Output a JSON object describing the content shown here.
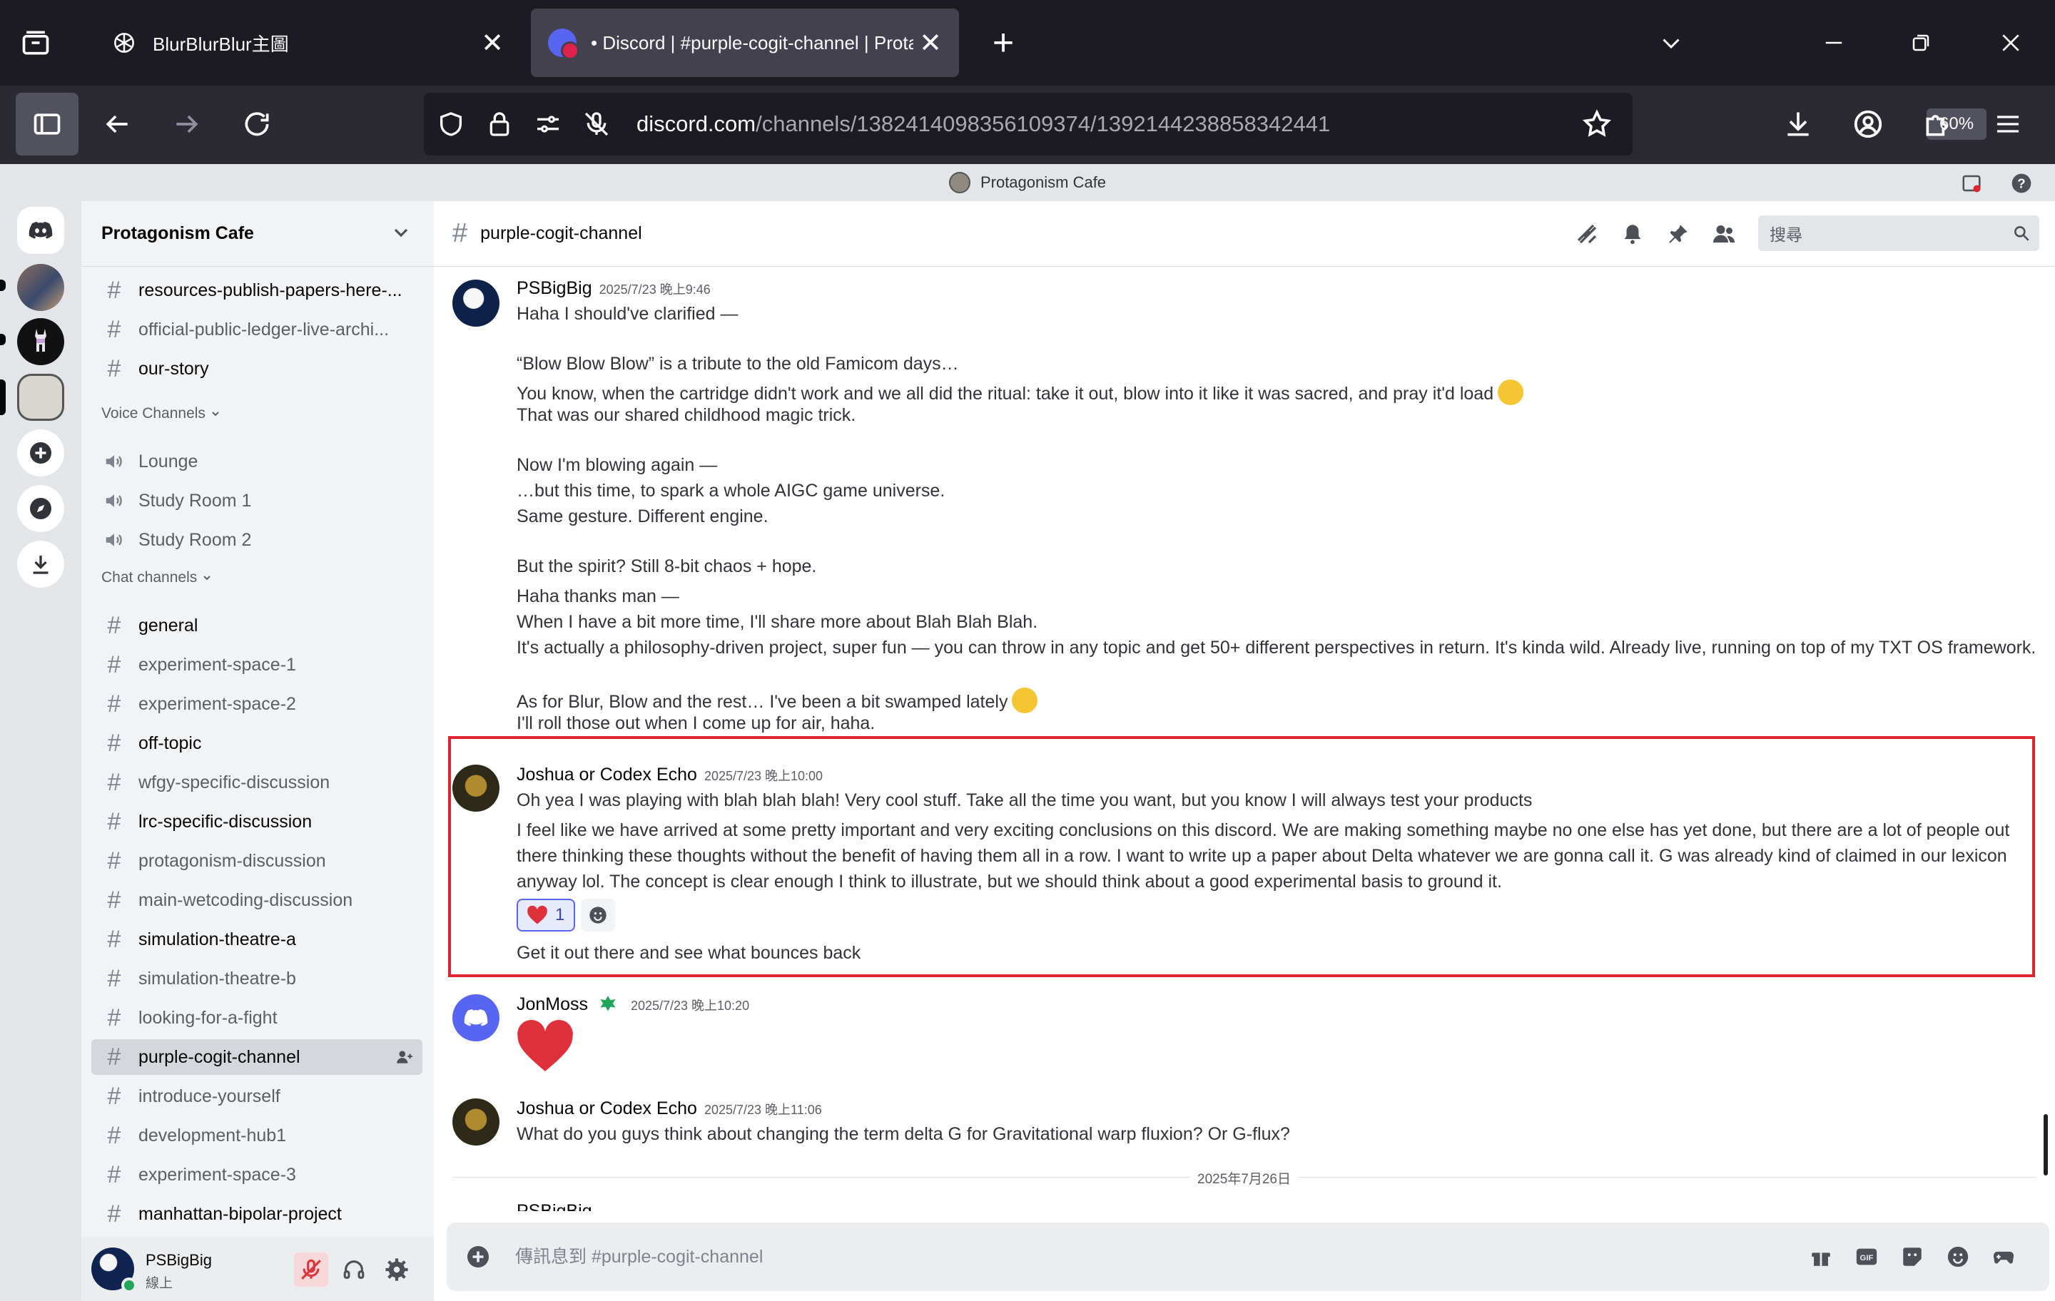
{
  "browser": {
    "tabs": [
      {
        "title": "BlurBlurBlur主圖",
        "active": false
      },
      {
        "title": "• Discord | #purple-cogit-channel | Prota",
        "active": true
      }
    ],
    "url_host": "discord.com",
    "url_path": "/channels/1382414098356109374/1392144238858342441",
    "zoom": "60%"
  },
  "top_strip": {
    "server_name": "Protagonism Cafe"
  },
  "server": {
    "name": "Protagonism Cafe"
  },
  "channels": {
    "top": [
      {
        "name": "resources-publish-papers-here-...",
        "bold": true,
        "unread": true
      },
      {
        "name": "official-public-ledger-live-archi...",
        "bold": false,
        "unread": false
      },
      {
        "name": "our-story",
        "bold": true,
        "unread": true
      }
    ],
    "voice_category": "Voice Channels",
    "voice": [
      "Lounge",
      "Study Room 1",
      "Study Room 2"
    ],
    "chat_category": "Chat channels",
    "chat": [
      {
        "name": "general",
        "bold": true,
        "unread": true
      },
      {
        "name": "experiment-space-1",
        "bold": false,
        "unread": false
      },
      {
        "name": "experiment-space-2",
        "bold": false,
        "unread": false
      },
      {
        "name": "off-topic",
        "bold": true,
        "unread": true
      },
      {
        "name": "wfgy-specific-discussion",
        "bold": false,
        "unread": false
      },
      {
        "name": "lrc-specific-discussion",
        "bold": true,
        "unread": true
      },
      {
        "name": "protagonism-discussion",
        "bold": false,
        "unread": false
      },
      {
        "name": "main-wetcoding-discussion",
        "bold": false,
        "unread": false
      },
      {
        "name": "simulation-theatre-a",
        "bold": true,
        "unread": true
      },
      {
        "name": "simulation-theatre-b",
        "bold": false,
        "unread": false
      },
      {
        "name": "looking-for-a-fight",
        "bold": false,
        "unread": false
      },
      {
        "name": "purple-cogit-channel",
        "bold": true,
        "unread": false,
        "selected": true
      },
      {
        "name": "introduce-yourself",
        "bold": false,
        "unread": false
      },
      {
        "name": "development-hub1",
        "bold": false,
        "unread": false
      },
      {
        "name": "experiment-space-3",
        "bold": false,
        "unread": false
      },
      {
        "name": "manhattan-bipolar-project",
        "bold": true,
        "unread": true
      }
    ]
  },
  "user": {
    "name": "PSBigBig",
    "status": "線上"
  },
  "channel_header": {
    "name": "purple-cogit-channel",
    "search_placeholder": "搜尋"
  },
  "messages": [
    {
      "author": "PSBigBig",
      "timestamp": "2025/7/23 晚上9:46",
      "lines": [
        "Haha I should've clarified —",
        "“Blow Blow Blow” is a tribute to the old Famicom days…",
        "You know, when the cartridge didn't work and we all did the ritual: take it out, blow into it like it was sacred, and pray it'd load",
        "That was our shared childhood magic trick.",
        "Now I'm blowing again —",
        "…but this time, to spark a whole AIGC game universe.",
        "Same gesture. Different engine.",
        "But the spirit? Still 8-bit chaos + hope.",
        "Haha thanks man —",
        "When I have a bit more time, I'll share more about Blah Blah Blah.",
        "It's actually a philosophy-driven project, super fun — you can throw in any topic and get 50+ different perspectives in return. It's kinda wild. Already live, running on top of my TXT OS framework.",
        "As for Blur, Blow and the rest… I've been a bit swamped lately",
        "I'll roll those out when I come up for air, haha."
      ]
    },
    {
      "author": "Joshua or Codex Echo",
      "timestamp": "2025/7/23 晚上10:00",
      "lines": [
        "Oh yea I was playing with blah blah blah! Very cool stuff. Take all the time you want, but you know I will always test your products",
        "I feel like we have arrived at some pretty important and very exciting conclusions on this discord. We are making something maybe no one else has yet done, but there are a lot of people out",
        "there thinking these thoughts without the benefit of having them all in a row. I want to write up a paper about Delta whatever we are gonna call it. G was already kind of claimed in our lexicon",
        "anyway lol. The concept is clear enough I think to illustrate, but we should think about a good experimental basis to ground it.",
        "Get it out there and see what bounces back"
      ],
      "reaction": {
        "emoji": "heart",
        "count": "1"
      }
    },
    {
      "author": "JonMoss",
      "timestamp": "2025/7/23 晚上10:20",
      "content_emoji": "heart"
    },
    {
      "author": "Joshua or Codex Echo",
      "timestamp": "2025/7/23 晚上11:06",
      "lines": [
        "What do you guys think about changing the term delta G for Gravitational warp fluxion? Or G-flux?"
      ]
    }
  ],
  "date_divider": "2025年7月26日",
  "next_author": "PSBigBig",
  "composer": {
    "placeholder": "傳訊息到 #purple-cogit-channel"
  },
  "colors": {
    "blurple": "#5865f2",
    "highlight": "#e0242e",
    "online": "#23a55a",
    "heart": "#e0303b"
  }
}
